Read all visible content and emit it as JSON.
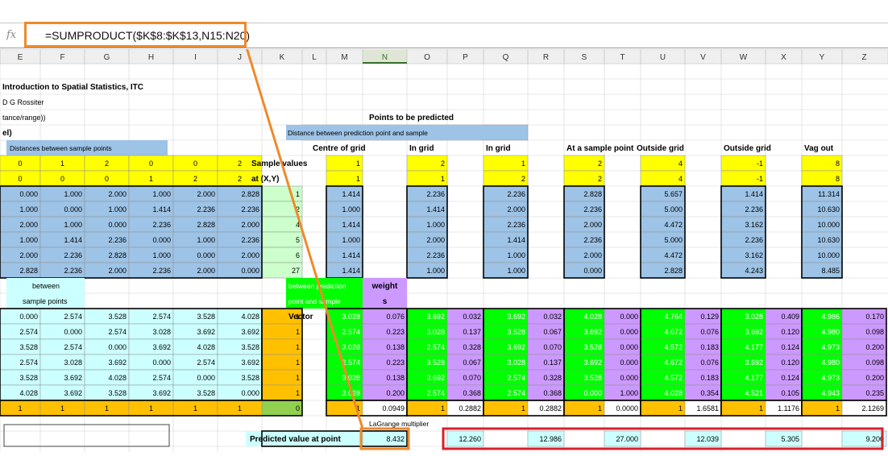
{
  "formula_bar": {
    "fx_label": "fx",
    "formula": "=SUMPRODUCT($K$8:$K$13,N15:N20)"
  },
  "columns": [
    "E",
    "F",
    "G",
    "H",
    "I",
    "J",
    "K",
    "L",
    "M",
    "N",
    "O",
    "P",
    "Q",
    "R",
    "S",
    "T",
    "U",
    "V",
    "W",
    "X",
    "Y",
    "Z"
  ],
  "labels": {
    "title": "Introduction to Spatial Statistics, ITC",
    "author": "D G Rossiter",
    "row3": "tance/range))",
    "row4": "el)",
    "points_to_predict": "Points to be predicted",
    "dist_pred_sample": "Distance between prediction point and sample",
    "dist_sample_points": "Distances between sample points",
    "sample_values": "Sample values",
    "at_xy": "at (X,Y)",
    "centre": "Centre of grid",
    "in_grid1": "In grid",
    "in_grid2": "In grid",
    "at_sample": "At a sample point",
    "outside1": "Outside grid",
    "outside2": "Outside grid",
    "vag_out": "Vag out",
    "between": "between",
    "sample_points": "sample points",
    "between_pred": "between prediction",
    "point_and_sample": "point and sample",
    "weight1": "weight",
    "weight2": "s",
    "vector": "Vector",
    "lagrange": "LaGrange multiplier",
    "predicted": "Predicted value at point"
  },
  "xy_rows": [
    [
      "0",
      "1",
      "2",
      "0",
      "0",
      "2"
    ],
    [
      "0",
      "0",
      "0",
      "1",
      "2",
      "2"
    ]
  ],
  "dist_matrix": [
    [
      "0.000",
      "1.000",
      "2.000",
      "1.000",
      "2.000",
      "2.828"
    ],
    [
      "1.000",
      "0.000",
      "1.000",
      "1.414",
      "2.236",
      "2.236"
    ],
    [
      "2.000",
      "1.000",
      "0.000",
      "2.236",
      "2.828",
      "2.000"
    ],
    [
      "1.000",
      "1.414",
      "2.236",
      "0.000",
      "1.000",
      "2.236"
    ],
    [
      "2.000",
      "2.236",
      "2.828",
      "1.000",
      "0.000",
      "2.000"
    ],
    [
      "2.828",
      "2.236",
      "2.000",
      "2.236",
      "2.000",
      "0.000"
    ]
  ],
  "sample_values": [
    "1",
    "2",
    "4",
    "5",
    "6",
    "27"
  ],
  "point_xy": [
    [
      "1",
      "2",
      "1",
      "2",
      "4",
      "-1",
      "8"
    ],
    [
      "1",
      "1",
      "2",
      "2",
      "4",
      "-1",
      "8"
    ]
  ],
  "pred_dist": [
    [
      "1.414",
      "2.236",
      "2.236",
      "2.828",
      "5.657",
      "1.414",
      "11.314"
    ],
    [
      "1.000",
      "1.414",
      "2.000",
      "2.236",
      "5.000",
      "2.236",
      "10.630"
    ],
    [
      "1.414",
      "1.000",
      "2.236",
      "2.000",
      "4.472",
      "3.162",
      "10.000"
    ],
    [
      "1.000",
      "2.000",
      "1.414",
      "2.236",
      "5.000",
      "2.236",
      "10.630"
    ],
    [
      "1.414",
      "2.236",
      "1.000",
      "2.000",
      "4.472",
      "3.162",
      "10.000"
    ],
    [
      "1.414",
      "1.000",
      "1.000",
      "0.000",
      "2.828",
      "4.243",
      "8.485"
    ]
  ],
  "semivar_matrix": [
    [
      "0.000",
      "2.574",
      "3.528",
      "2.574",
      "3.528",
      "4.028"
    ],
    [
      "2.574",
      "0.000",
      "2.574",
      "3.028",
      "3.692",
      "3.692"
    ],
    [
      "3.528",
      "2.574",
      "0.000",
      "3.692",
      "4.028",
      "3.528"
    ],
    [
      "2.574",
      "3.028",
      "3.692",
      "0.000",
      "2.574",
      "3.692"
    ],
    [
      "3.528",
      "3.692",
      "4.028",
      "2.574",
      "0.000",
      "3.528"
    ],
    [
      "4.028",
      "3.692",
      "3.528",
      "3.692",
      "3.528",
      "0.000"
    ]
  ],
  "ones": [
    "1",
    "1",
    "1",
    "1",
    "1",
    "1"
  ],
  "bottom_row": [
    "1",
    "1",
    "1",
    "1",
    "1",
    "1",
    "0"
  ],
  "pairs": [
    [
      [
        "3.028",
        "0.076"
      ],
      [
        "3.692",
        "0.032"
      ],
      [
        "3.692",
        "0.032"
      ],
      [
        "4.028",
        "0.000"
      ],
      [
        "4.764",
        "0.129"
      ],
      [
        "3.028",
        "0.409"
      ],
      [
        "4.986",
        "0.170"
      ]
    ],
    [
      [
        "2.574",
        "0.223"
      ],
      [
        "3.028",
        "0.137"
      ],
      [
        "3.528",
        "0.067"
      ],
      [
        "3.692",
        "0.000"
      ],
      [
        "4.672",
        "0.076"
      ],
      [
        "3.692",
        "0.120"
      ],
      [
        "4.980",
        "0.098"
      ]
    ],
    [
      [
        "3.028",
        "0.138"
      ],
      [
        "2.574",
        "0.328"
      ],
      [
        "3.692",
        "0.070"
      ],
      [
        "3.528",
        "0.000"
      ],
      [
        "4.572",
        "0.183"
      ],
      [
        "4.177",
        "0.124"
      ],
      [
        "4.973",
        "0.200"
      ]
    ],
    [
      [
        "2.574",
        "0.223"
      ],
      [
        "3.528",
        "0.067"
      ],
      [
        "3.028",
        "0.137"
      ],
      [
        "3.692",
        "0.000"
      ],
      [
        "4.672",
        "0.076"
      ],
      [
        "3.692",
        "0.120"
      ],
      [
        "4.980",
        "0.098"
      ]
    ],
    [
      [
        "3.028",
        "0.138"
      ],
      [
        "3.692",
        "0.070"
      ],
      [
        "2.574",
        "0.328"
      ],
      [
        "3.528",
        "0.000"
      ],
      [
        "4.572",
        "0.183"
      ],
      [
        "4.177",
        "0.124"
      ],
      [
        "4.973",
        "0.200"
      ]
    ],
    [
      [
        "3.028",
        "0.200"
      ],
      [
        "2.574",
        "0.368"
      ],
      [
        "2.574",
        "0.368"
      ],
      [
        "0.000",
        "1.000"
      ],
      [
        "4.028",
        "0.354"
      ],
      [
        "4.521",
        "0.105"
      ],
      [
        "4.943",
        "0.235"
      ]
    ]
  ],
  "lagrange": [
    [
      "1",
      "0.0949"
    ],
    [
      "1",
      "0.2882"
    ],
    [
      "1",
      "0.2882"
    ],
    [
      "1",
      "0.0000"
    ],
    [
      "1",
      "1.6581"
    ],
    [
      "1",
      "1.1176"
    ],
    [
      "1",
      "2.1269"
    ]
  ],
  "predicted": [
    "8.432",
    "12.260",
    "12.986",
    "27.000",
    "12.039",
    "5.305",
    "9.200"
  ],
  "colors": {
    "blue": "#9dc3e6",
    "yellow": "#ffff00",
    "light_blue": "#ccffff",
    "light_green": "#ccffcc",
    "orange": "#ffc000",
    "green": "#00ff00",
    "purple": "#cc99ff",
    "olive": "#92d050",
    "highlight_orange": "#ee8a2b",
    "highlight_red": "#d9202e"
  }
}
